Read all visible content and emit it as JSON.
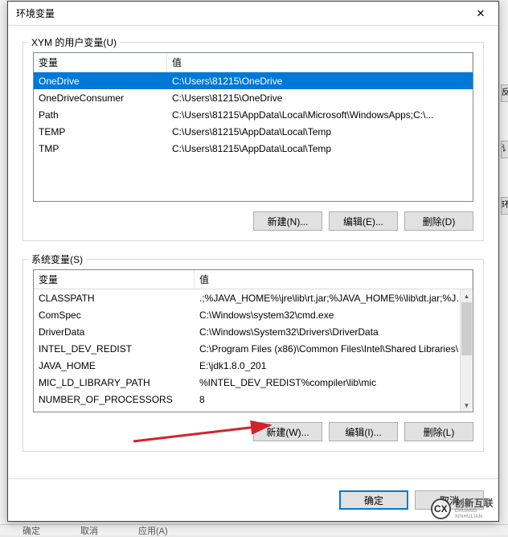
{
  "dialog": {
    "title": "环境变量",
    "close_glyph": "✕"
  },
  "user_section": {
    "legend": "XYM 的用户变量(U)",
    "headers": {
      "var": "变量",
      "val": "值"
    },
    "rows": [
      {
        "var": "OneDrive",
        "val": "C:\\Users\\81215\\OneDrive",
        "selected": true
      },
      {
        "var": "OneDriveConsumer",
        "val": "C:\\Users\\81215\\OneDrive",
        "selected": false
      },
      {
        "var": "Path",
        "val": "C:\\Users\\81215\\AppData\\Local\\Microsoft\\WindowsApps;C:\\...",
        "selected": false
      },
      {
        "var": "TEMP",
        "val": "C:\\Users\\81215\\AppData\\Local\\Temp",
        "selected": false
      },
      {
        "var": "TMP",
        "val": "C:\\Users\\81215\\AppData\\Local\\Temp",
        "selected": false
      }
    ],
    "buttons": {
      "new": "新建(N)...",
      "edit": "编辑(E)...",
      "delete": "删除(D)"
    }
  },
  "sys_section": {
    "legend": "系统变量(S)",
    "headers": {
      "var": "变量",
      "val": "值"
    },
    "rows": [
      {
        "var": "CLASSPATH",
        "val": ".;%JAVA_HOME%\\jre\\lib\\rt.jar;%JAVA_HOME%\\lib\\dt.jar;%JAV..."
      },
      {
        "var": "ComSpec",
        "val": "C:\\Windows\\system32\\cmd.exe"
      },
      {
        "var": "DriverData",
        "val": "C:\\Windows\\System32\\Drivers\\DriverData"
      },
      {
        "var": "INTEL_DEV_REDIST",
        "val": "C:\\Program Files (x86)\\Common Files\\Intel\\Shared Libraries\\"
      },
      {
        "var": "JAVA_HOME",
        "val": "E:\\jdk1.8.0_201"
      },
      {
        "var": "MIC_LD_LIBRARY_PATH",
        "val": "%INTEL_DEV_REDIST%compiler\\lib\\mic"
      },
      {
        "var": "NUMBER_OF_PROCESSORS",
        "val": "8"
      }
    ],
    "buttons": {
      "new": "新建(W)...",
      "edit": "编辑(I)...",
      "delete": "删除(L)"
    }
  },
  "footer": {
    "ok": "确定",
    "cancel": "取消"
  },
  "bg": {
    "btn1": "确定",
    "btn2": "取消",
    "btn3": "应用(A)",
    "side1": "反",
    "side2": "讠",
    "side3": "环"
  },
  "watermark": {
    "logo": "CX",
    "cn": "创新互联",
    "en": "CHUANG XINHULIAN"
  }
}
